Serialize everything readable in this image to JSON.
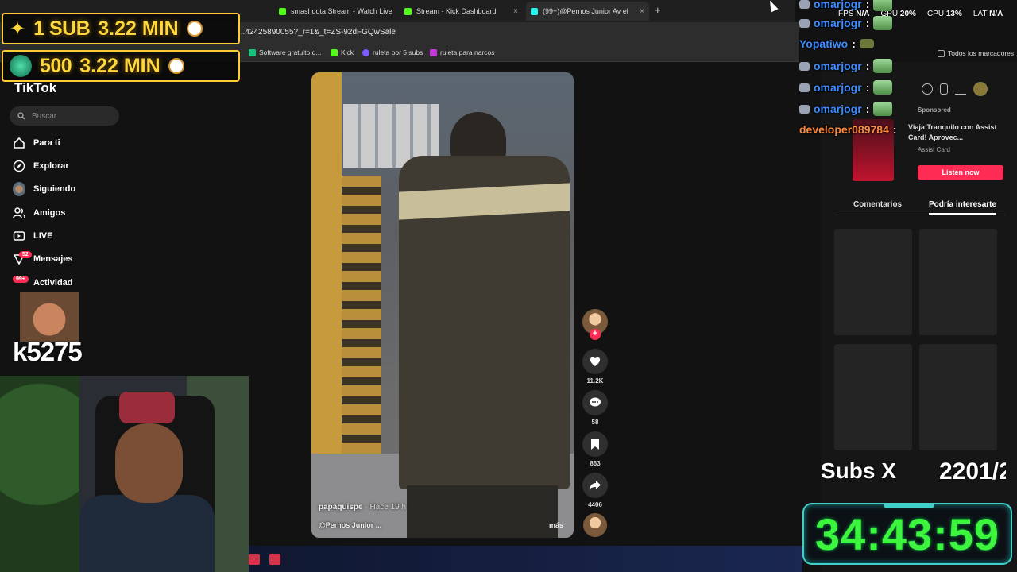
{
  "browser": {
    "tabs": [
      {
        "label": "smashdota Stream - Watch Live",
        "color": "#53fc18"
      },
      {
        "label": "Stream - Kick Dashboard",
        "color": "#53fc18"
      },
      {
        "label": "(99+)@Pernos Junior Av el",
        "color": "#25f4ee"
      }
    ],
    "url": "...42425890055?_r=1&_t=ZS-92dFGQwSale",
    "bookmarks": [
      {
        "label": "Software gratuito d...",
        "color": "#19c37d"
      },
      {
        "label": "Kick",
        "color": "#53fc18"
      },
      {
        "label": "ruleta por 5 subs",
        "color": "#7b5cff"
      },
      {
        "label": "ruleta para narcos",
        "color": "#c23bd6"
      }
    ],
    "bookmarks_all": "Todos los marcadores"
  },
  "overlay_goals": {
    "sub_goal": {
      "label": "1 SUB",
      "value": "3.22 MIN"
    },
    "gift_goal": {
      "label": "500",
      "value": "3.22 MIN"
    }
  },
  "sidebar": {
    "logo": "TikTok",
    "search_placeholder": "Buscar",
    "items": [
      {
        "label": "Para ti",
        "icon": "home-icon"
      },
      {
        "label": "Explorar",
        "icon": "compass-icon"
      },
      {
        "label": "Siguiendo",
        "icon": "following-avatar"
      },
      {
        "label": "Amigos",
        "icon": "friends-icon"
      },
      {
        "label": "LIVE",
        "icon": "live-icon"
      },
      {
        "label": "Mensajes",
        "icon": "messages-icon",
        "badge": "52"
      },
      {
        "label": "Actividad",
        "icon": "activity-icon",
        "badge": "99+"
      }
    ]
  },
  "video": {
    "author": "papaquispe",
    "time": " · Hace 19 h",
    "sound": "@Pernos Junior ...",
    "more": "más",
    "likes": "11.2K",
    "comments": "58",
    "saves": "863",
    "shares": "4406"
  },
  "right_panel": {
    "sponsored": "Sponsored",
    "ad_title": "Viaja Tranquilo con Assist Card! Aprovec...",
    "ad_source": "Assist Card",
    "ad_button": "Listen now",
    "tab_comments": "Comentarios",
    "tab_interest": "Podría interesarte"
  },
  "stats": {
    "fps_label": "FPS",
    "fps": "N/A",
    "gpu_label": "GPU",
    "gpu": "20%",
    "cpu_label": "CPU",
    "cpu": "13%",
    "lat_label": "LAT",
    "lat": "N/A"
  },
  "chat": [
    {
      "name": "omarjogr",
      "color": "#3d8bff"
    },
    {
      "name": "omarjogr",
      "color": "#3d8bff"
    },
    {
      "name": "Yopatiwo",
      "color": "#3d8bff"
    },
    {
      "name": "omarjogr",
      "color": "#3d8bff"
    },
    {
      "name": "omarjogr",
      "color": "#3d8bff"
    },
    {
      "name": "omarjogr",
      "color": "#3d8bff"
    },
    {
      "name": "developer089784",
      "color": "#ff8a3d"
    }
  ],
  "counter": "k5275",
  "subs_x": {
    "label": "Subs X",
    "value": "2201/2"
  },
  "timer": "34:43:59"
}
